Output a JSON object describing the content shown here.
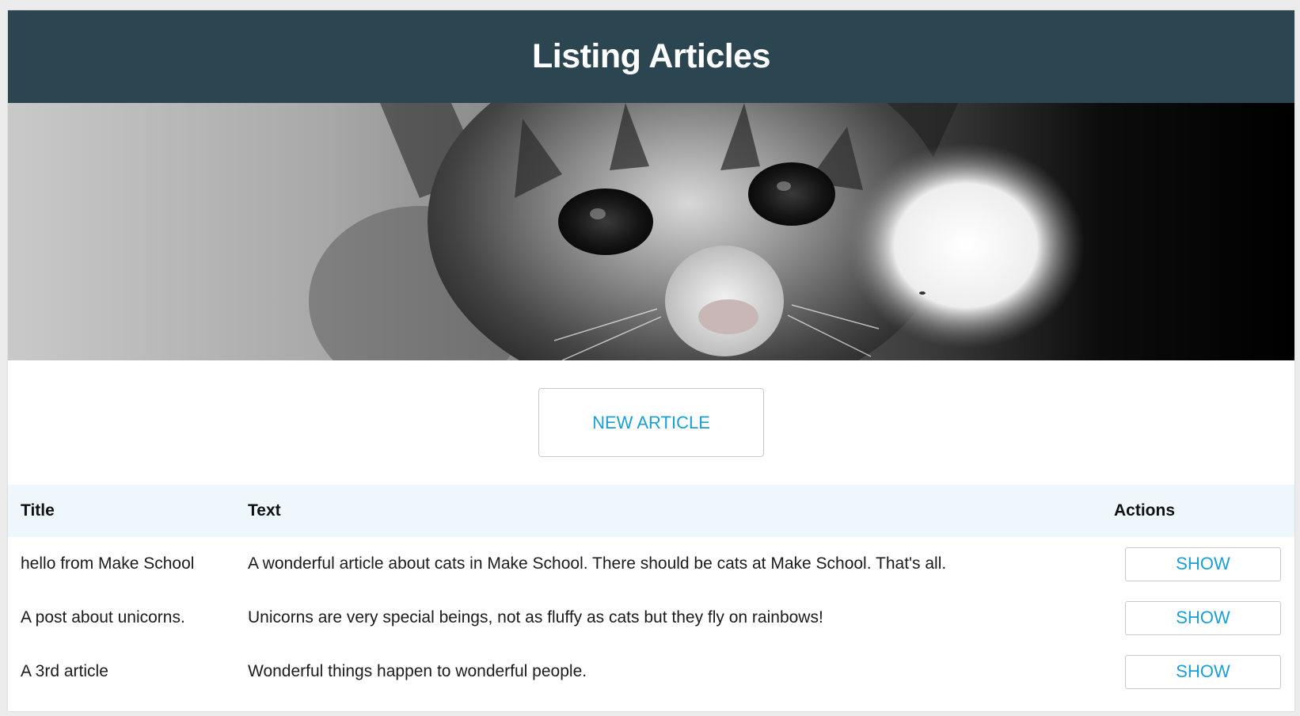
{
  "header": {
    "title": "Listing Articles"
  },
  "hero": {
    "image": "kitten-photo"
  },
  "actions": {
    "new_article_label": "NEW ARTICLE"
  },
  "table": {
    "headers": {
      "title": "Title",
      "text": "Text",
      "actions": "Actions"
    },
    "rows": [
      {
        "title": "hello from Make School",
        "text": "A wonderful article about cats in Make School. There should be cats at Make School. That's all.",
        "action": "SHOW"
      },
      {
        "title": "A post about unicorns.",
        "text": "Unicorns are very special beings, not as fluffy as cats but they fly on rainbows!",
        "action": "SHOW"
      },
      {
        "title": "A 3rd article",
        "text": "Wonderful things happen to wonderful people.",
        "action": "SHOW"
      }
    ]
  },
  "colors": {
    "header_bg": "#2b4650",
    "accent": "#1a9fd4",
    "table_header_bg": "#eef7fb"
  }
}
